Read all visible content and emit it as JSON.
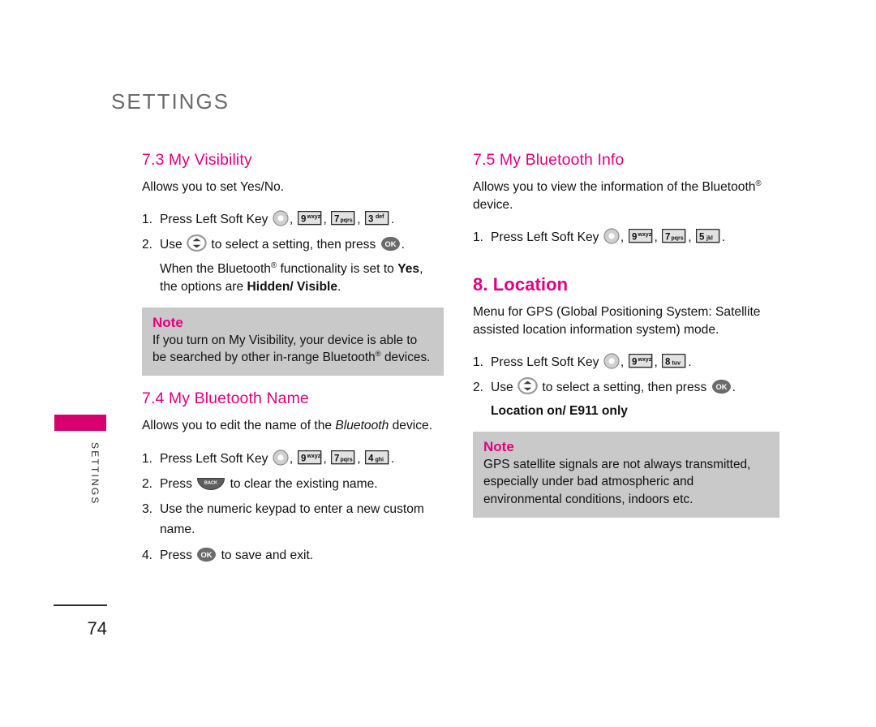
{
  "page": {
    "chapter_title": "SETTINGS",
    "side_label": "SETTINGS",
    "page_number": "74"
  },
  "note_label": "Note",
  "sections": {
    "my_visibility": {
      "heading": "7.3 My Visibility",
      "intro": "Allows you to set Yes/No.",
      "step1_num": "1.",
      "step1_a": "Press Left Soft Key",
      "step1_keys": [
        "9wxyz",
        "7pqrs",
        "3def"
      ],
      "step2_num": "2.",
      "step2_a": "Use",
      "step2_b": "to select a setting, then press",
      "sub_a": "When the Bluetooth",
      "sub_b": " functionality is set to ",
      "sub_yes": "Yes",
      "sub_c": ",",
      "sub_d": "the options are ",
      "sub_hidden": "Hidden",
      "sub_slash": "/ ",
      "sub_visible": "Visible",
      "sub_end": ".",
      "note_line1": "If you turn on My Visibility, your device is able to",
      "note_line2_a": "be searched by other in-range Bluetooth",
      "note_line2_b": " devices."
    },
    "my_bluetooth_name": {
      "heading": "7.4 My Bluetooth Name",
      "intro_a": "Allows you to edit the name of the ",
      "intro_italic": "Bluetooth",
      "intro_b": " device.",
      "step1_num": "1.",
      "step1_a": "Press Left Soft Key",
      "step1_keys": [
        "9wxyz",
        "7pqrs",
        "4ghi"
      ],
      "step2_num": "2.",
      "step2_a": "Press",
      "step2_b": "to clear the existing name.",
      "step3_num": "3.",
      "step3_a": "Use the numeric keypad to enter a new custom",
      "step3_b": "name.",
      "step4_num": "4.",
      "step4_a": "Press",
      "step4_b": "to save and exit."
    },
    "my_bluetooth_info": {
      "heading": "7.5 My Bluetooth Info",
      "intro_a": "Allows you to view the information of the Bluetooth",
      "intro_b": "device.",
      "step1_num": "1.",
      "step1_a": "Press Left Soft Key",
      "step1_keys": [
        "9wxyz",
        "7pqrs",
        "5jkl"
      ]
    },
    "location": {
      "heading": "8. Location",
      "intro_line1": "Menu for GPS (Global Positioning System: Satellite",
      "intro_line2": "assisted location information system) mode.",
      "step1_num": "1.",
      "step1_a": "Press Left Soft Key",
      "step1_keys": [
        "9wxyz",
        "8tuv"
      ],
      "step2_num": "2.",
      "step2_a": "Use",
      "step2_b": "to select a setting, then press",
      "options": "Location on/ E911 only",
      "note_line1": "GPS satellite signals are not always transmitted,",
      "note_line2": "especially under bad atmospheric and",
      "note_line3": "environmental conditions, indoors etc."
    }
  },
  "keys": {
    "k9": {
      "digit": "9",
      "letters": "wxyz"
    },
    "k7": {
      "digit": "7",
      "letters": "pqrs"
    },
    "k3": {
      "digit": "3",
      "letters": "def"
    },
    "k4": {
      "digit": "4",
      "letters": "ghi"
    },
    "k5": {
      "digit": "5",
      "letters": "jkl"
    },
    "k8": {
      "digit": "8",
      "letters": "tuv"
    },
    "ok": {
      "label": "OK"
    },
    "back": {
      "label": "BACK"
    }
  },
  "colors": {
    "accent_magenta": "#e3007d",
    "tab_magenta": "#d6006e",
    "note_bg": "#c9c9c9",
    "chapter_gray": "#6b6b6b",
    "key_fill": "#d9d9d9",
    "key_dark": "#6a6a6a"
  }
}
